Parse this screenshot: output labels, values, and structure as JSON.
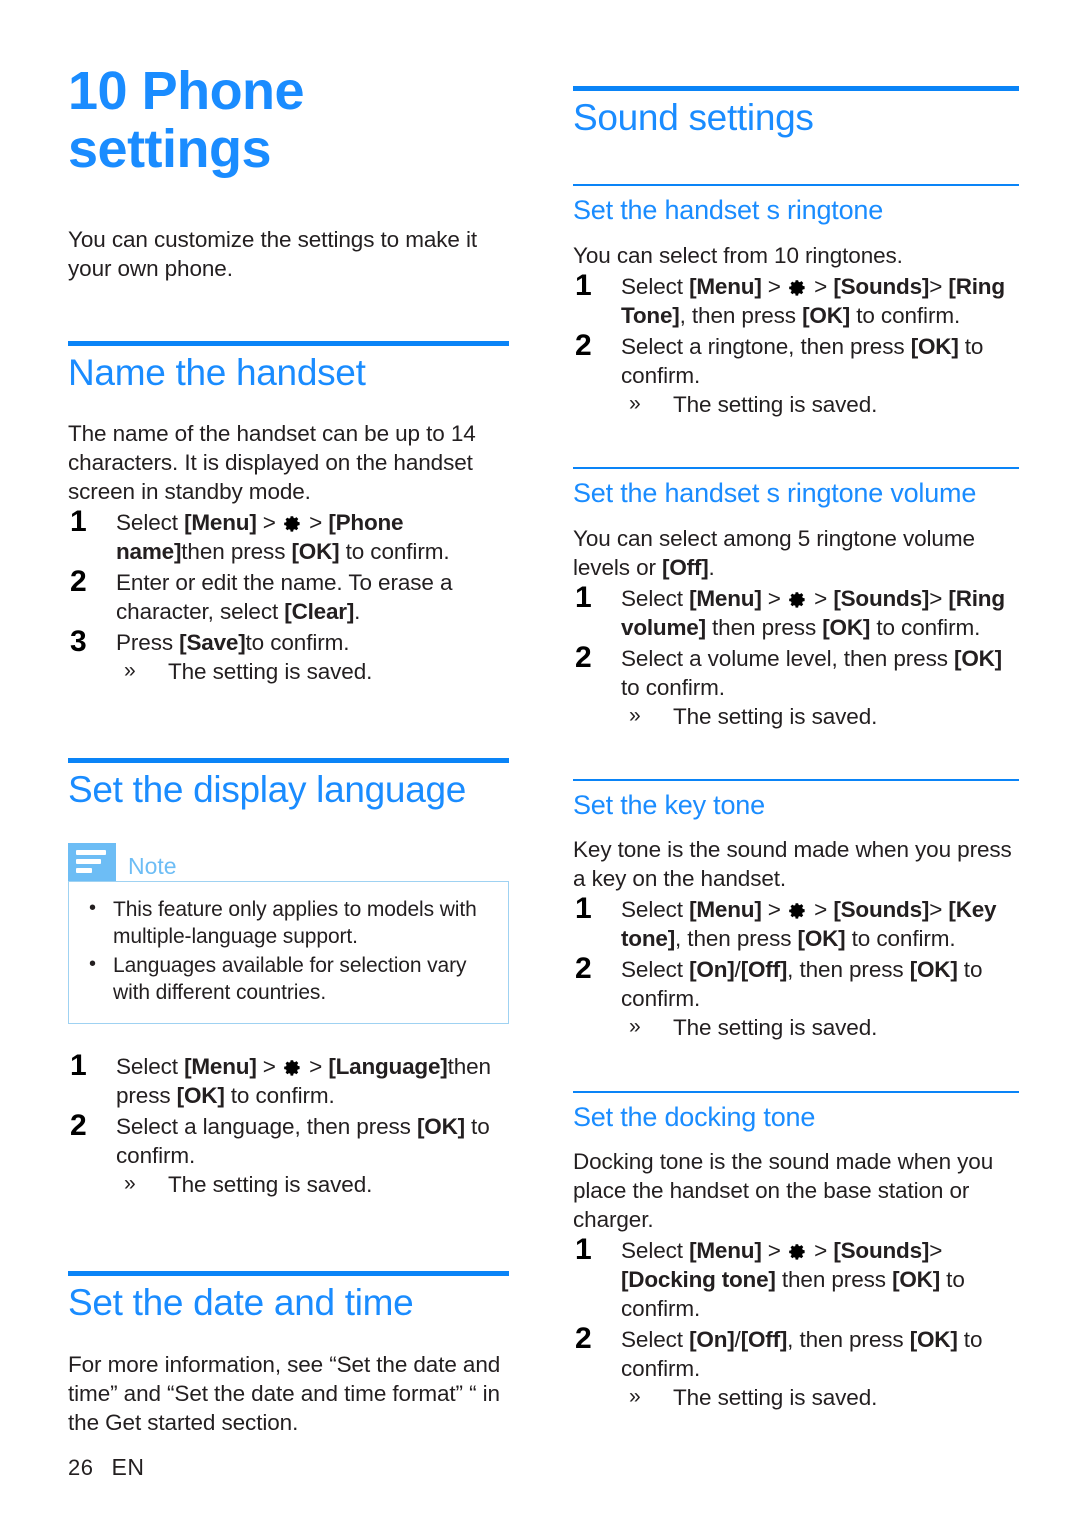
{
  "chapter": {
    "title": "10 Phone settings",
    "intro": "You can customize the settings to make it your own phone."
  },
  "footer": {
    "page_number": "26",
    "language_code": "EN"
  },
  "icons": {
    "settings": "gear-icon",
    "note": "note-icon"
  },
  "left_column": {
    "sections": [
      {
        "heading": "Name the handset",
        "intro": "The name of the handset can be up to 14 characters. It is displayed on the handset screen in standby mode.",
        "steps": [
          {
            "prefix": "Select ",
            "k1": "[Menu]",
            "sep1": " > ",
            "gear": true,
            "sep2": " > ",
            "k2": "[Phone name]",
            "mid": "then press ",
            "k3": "[OK]",
            "suffix": " to confirm."
          },
          {
            "prefix": "Enter or edit the name. To erase a character, select ",
            "k1": "[Clear]",
            "suffix": "."
          },
          {
            "prefix": "Press ",
            "k1": "[Save]",
            "suffix": "to confirm."
          }
        ],
        "result": "The setting is saved."
      },
      {
        "heading": "Set the display language",
        "note": {
          "label": "Note",
          "items": [
            "This feature only applies to models with multiple-language support.",
            "Languages available for selection vary with different countries."
          ]
        },
        "steps": [
          {
            "prefix": "Select ",
            "k1": "[Menu]",
            "sep1": " > ",
            "gear": true,
            "sep2": " > ",
            "k2": "[Language]",
            "mid": "then press ",
            "k3": "[OK]",
            "suffix": " to confirm."
          },
          {
            "prefix": "Select a language, then press ",
            "k1": "[OK]",
            "suffix": " to confirm."
          }
        ],
        "result": "The setting is saved."
      },
      {
        "heading": "Set the date and time",
        "intro": "For more information, see “Set the date and time” and “Set the date and time format” “ in the Get started section."
      }
    ]
  },
  "right_column": {
    "heading": "Sound settings",
    "subsections": [
      {
        "heading": "Set the handset s ringtone",
        "intro": "You can select from 10 ringtones.",
        "steps": [
          {
            "prefix": "Select ",
            "k1": "[Menu]",
            "sep1": " > ",
            "gear": true,
            "sep2": " > ",
            "k2": "[Sounds]",
            "sep3": "> ",
            "k3": "[Ring Tone]",
            "mid": ", then press ",
            "k4": "[OK]",
            "suffix": " to confirm."
          },
          {
            "prefix": "Select a ringtone, then press ",
            "k1": "[OK]",
            "suffix": " to confirm."
          }
        ],
        "result": "The setting is saved."
      },
      {
        "heading": "Set the handset s ringtone volume",
        "intro_a": "You can select among 5 ringtone volume levels or ",
        "intro_key": "[Off]",
        "intro_b": ".",
        "steps": [
          {
            "prefix": "Select ",
            "k1": "[Menu]",
            "sep1": " > ",
            "gear": true,
            "sep2": " > ",
            "k2": "[Sounds]",
            "sep3": "> ",
            "k3": "[Ring volume]",
            "mid": " then press ",
            "k4": "[OK]",
            "suffix": " to confirm."
          },
          {
            "prefix": "Select a volume level, then press ",
            "k1": "[OK]",
            "suffix": " to confirm."
          }
        ],
        "result": "The setting is saved."
      },
      {
        "heading": "Set the key tone",
        "intro": "Key tone is the sound made when you press a key on the handset.",
        "steps": [
          {
            "prefix": "Select ",
            "k1": "[Menu]",
            "sep1": " > ",
            "gear": true,
            "sep2": " > ",
            "k2": "[Sounds]",
            "sep3": "> ",
            "k3": "[Key tone]",
            "mid": ", then press ",
            "k4": "[OK]",
            "suffix": " to confirm."
          },
          {
            "prefix": "Select ",
            "k1": "[On]",
            "slash": "/",
            "k2": "[Off]",
            "mid": ", then press ",
            "k4": "[OK]",
            "suffix": " to confirm."
          }
        ],
        "result": "The setting is saved."
      },
      {
        "heading": "Set the docking tone",
        "intro": "Docking tone is the sound made when you place the handset on the base station or charger.",
        "steps": [
          {
            "prefix": "Select ",
            "k1": "[Menu]",
            "sep1": " > ",
            "gear": true,
            "sep2": " > ",
            "k2": "[Sounds]",
            "sep3": "> ",
            "k3": "[Docking tone]",
            "mid": " then press ",
            "k4": "[OK]",
            "suffix": " to confirm."
          },
          {
            "prefix": "Select ",
            "k1": "[On]",
            "slash": "/",
            "k2": "[Off]",
            "mid": ", then press ",
            "k4": "[OK]",
            "suffix": " to confirm."
          }
        ],
        "result": "The setting is saved."
      }
    ]
  },
  "colors": {
    "heading_blue": "#1a8cff",
    "rule_blue": "#0a84f7",
    "note_icon_blue": "#6dbdf5",
    "note_border_blue": "#9fd2f2",
    "body_text": "#231f20"
  }
}
